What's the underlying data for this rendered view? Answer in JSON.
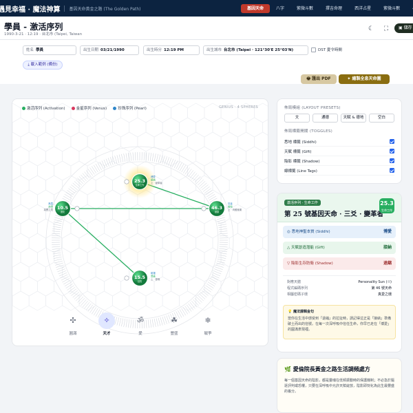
{
  "nav": {
    "brand": "遇見幸福 · 魔法神算",
    "brand_sub": "基因天命黃金之路 (The Golden Path)",
    "items": [
      {
        "label": "基因天命",
        "active": true
      },
      {
        "label": "八字",
        "active": false
      },
      {
        "label": "紫微斗數",
        "active": false
      },
      {
        "label": "擇吉命理",
        "active": false
      },
      {
        "label": "西洋占星",
        "active": false
      },
      {
        "label": "紫微斗數",
        "active": false
      },
      {
        "label": "小六壬",
        "active": false
      },
      {
        "label": "文王",
        "active": false
      }
    ]
  },
  "header": {
    "title": "學員 - 激活序列",
    "subtitle": "1990-3-21 · 12:19 · 台北市 (Taipei, Taiwan",
    "save_label": "儲存",
    "icons": [
      "moon-icon",
      "fullscreen-icon"
    ]
  },
  "form": {
    "name_label": "姓名",
    "name_value": "學員",
    "date_label": "出生日期",
    "date_value": "03/21/1990",
    "time_label": "出生時分",
    "time_value": "12:19 PM",
    "city_label": "出生城市",
    "city_value": "台北市 (Taipei · 121°30'E 25°03'N)",
    "dst_label": "DST 夏令時間",
    "sample_label": "載入範例 (備份)"
  },
  "actions": {
    "pdf_label": "匯出 PDF",
    "print_label": "繪製全息天命圖"
  },
  "chart_data": {
    "type": "diagram",
    "legend": [
      {
        "name": "激活序列 (Activation)",
        "color": "#27ae60"
      },
      {
        "name": "金星序列 (Venus)",
        "color": "#d9385e"
      },
      {
        "name": "珍珠序列 (Pearl)",
        "color": "#2f86c9"
      }
    ],
    "genius_label": "GENIUS · 4 SPHERES",
    "spheres": [
      {
        "id": "top",
        "value": "25.3",
        "label": "生命工作",
        "glow": true,
        "tags": [
          "博愛",
          "接納",
          "上 · 變革者"
        ]
      },
      {
        "id": "left",
        "value": "10.5",
        "label": "進化",
        "glow": false,
        "tags": [
          "無畏",
          "自然",
          "真實之境"
        ]
      },
      {
        "id": "right",
        "value": "46.3",
        "label": "健康",
        "glow": false,
        "tags": [
          "狂喜",
          "愉悅",
          "上 · 肉體極樂"
        ]
      },
      {
        "id": "bottom",
        "value": "15.5",
        "label": "目的",
        "glow": false,
        "tags": [
          "磁場",
          "豐盛",
          "上 · 慷慨"
        ]
      }
    ],
    "connections": [
      [
        "top",
        "right"
      ],
      [
        "left",
        "right"
      ],
      [
        "left",
        "bottom"
      ]
    ]
  },
  "toolbar": [
    {
      "label": "圓滿",
      "icon": "✣",
      "name": "fullness-tool",
      "active": false
    },
    {
      "label": "天才",
      "icon": "✧",
      "name": "genius-tool",
      "active": true
    },
    {
      "label": "愛",
      "icon": "ॐ",
      "name": "love-tool",
      "active": false
    },
    {
      "label": "豐盛",
      "icon": "☘",
      "name": "abundance-tool",
      "active": false
    },
    {
      "label": "戰爭",
      "icon": "❄",
      "name": "war-tool",
      "active": false
    }
  ],
  "layout_panel": {
    "preset_title": "佈局模組 (LAYOUT PRESETS)",
    "presets": [
      "文",
      "通德",
      "天賦 & 德地",
      "空白"
    ],
    "toggle_title": "佈局標籤開關 (TOGGLES)",
    "toggles": [
      {
        "label": "悉地 標籤 (Siddhi)",
        "checked": true
      },
      {
        "label": "天賦 標籤 (Gift)",
        "checked": true
      },
      {
        "label": "陰影 標籤 (Shadow)",
        "checked": true
      },
      {
        "label": "線標籤 (Line Tags)",
        "checked": true
      }
    ]
  },
  "gene_key": {
    "pill": "激活序列 · 生命工作",
    "title": "第 25 號基因天命 · 三爻 · 變革者",
    "number": "25.3",
    "number_sub": "生命工作",
    "siddhi_label": "悉地神聖本質 (Siddhi)",
    "siddhi_value": "博愛",
    "gift_label": "天賦創造潛能 (Gift)",
    "gift_value": "接納",
    "shadow_label": "陰影生存防衛 (Shadow)",
    "shadow_value": "退縮",
    "info": [
      {
        "k": "對應天體",
        "v": "Personality Sun (☉)"
      },
      {
        "k": "程式編碼序列",
        "v": "第 46 號天命"
      },
      {
        "k": "相屬密碼子環",
        "v": "真愛之環"
      }
    ],
    "quote_title": "魔法課輯金句",
    "quote_body": "當你在生活中感受到「退縮」的拉扯時，請記得這正是「接納」準備破土而出的信號。在每一次深呼吸中信任生命，你早已走在「博愛」的圓滿表現裡。"
  },
  "bottom_card": {
    "title": "愛倫院長黃金之路生活調頻處方",
    "body": "每一個基因天命的陰影，都是靈魂在低頻振動時的保護機制；不必急於驅逐評判或恐懼，只要在深呼吸中允許天賦綻放，陰影即刻化為此生最豐盛的養分。"
  }
}
